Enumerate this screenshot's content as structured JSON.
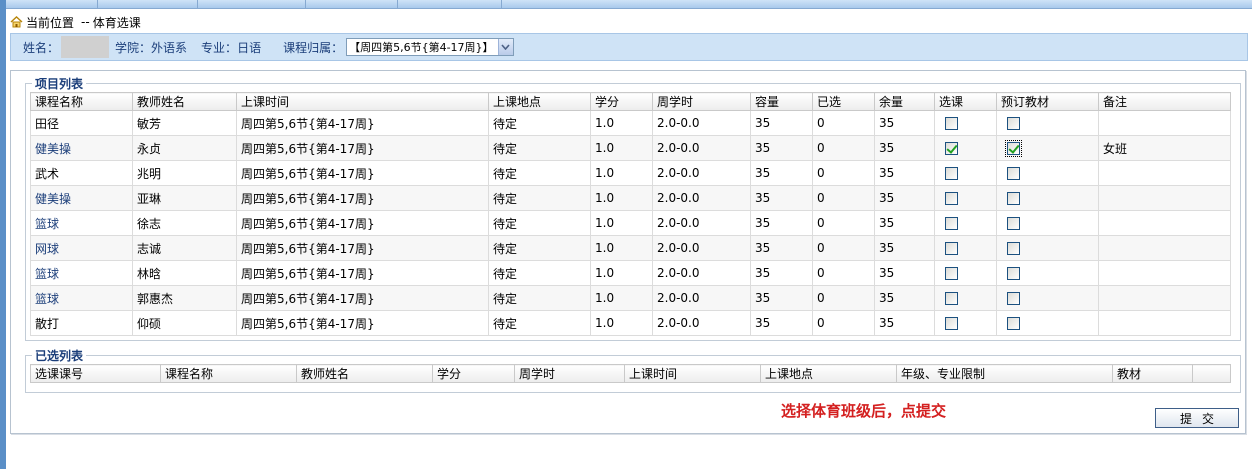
{
  "breadcrumb": {
    "prefix": "当前位置",
    "separator": "--",
    "page": "体育选课"
  },
  "info": {
    "name_label": "姓名：",
    "college_label": "学院：",
    "college_value": "外语系",
    "major_label": "专业：",
    "major_value": "日语",
    "belong_label": "课程归属：",
    "belong_selected": "【周四第5,6节{第4-17周}】"
  },
  "project_list": {
    "legend": "项目列表",
    "headers": [
      "课程名称",
      "教师姓名",
      "上课时间",
      "上课地点",
      "学分",
      "周学时",
      "容量",
      "已选",
      "余量",
      "选课",
      "预订教材",
      "备注"
    ],
    "rows": [
      {
        "course": "田径",
        "teacher": "敏芳",
        "time": "周四第5,6节{第4-17周}",
        "place": "待定",
        "credit": "1.0",
        "hours": "2.0-0.0",
        "capacity": "35",
        "selected": "0",
        "remaining": "35",
        "choose": false,
        "book": false,
        "note": ""
      },
      {
        "course": "健美操",
        "teacher": "永贞",
        "time": "周四第5,6节{第4-17周}",
        "place": "待定",
        "credit": "1.0",
        "hours": "2.0-0.0",
        "capacity": "35",
        "selected": "0",
        "remaining": "35",
        "choose": true,
        "book": true,
        "note": "女班"
      },
      {
        "course": "武术",
        "teacher": "兆明",
        "time": "周四第5,6节{第4-17周}",
        "place": "待定",
        "credit": "1.0",
        "hours": "2.0-0.0",
        "capacity": "35",
        "selected": "0",
        "remaining": "35",
        "choose": false,
        "book": false,
        "note": ""
      },
      {
        "course": "健美操",
        "teacher": "亚琳",
        "time": "周四第5,6节{第4-17周}",
        "place": "待定",
        "credit": "1.0",
        "hours": "2.0-0.0",
        "capacity": "35",
        "selected": "0",
        "remaining": "35",
        "choose": false,
        "book": false,
        "note": ""
      },
      {
        "course": "篮球",
        "teacher": "徐志",
        "time": "周四第5,6节{第4-17周}",
        "place": "待定",
        "credit": "1.0",
        "hours": "2.0-0.0",
        "capacity": "35",
        "selected": "0",
        "remaining": "35",
        "choose": false,
        "book": false,
        "note": ""
      },
      {
        "course": "网球",
        "teacher": "志诚",
        "time": "周四第5,6节{第4-17周}",
        "place": "待定",
        "credit": "1.0",
        "hours": "2.0-0.0",
        "capacity": "35",
        "selected": "0",
        "remaining": "35",
        "choose": false,
        "book": false,
        "note": ""
      },
      {
        "course": "篮球",
        "teacher": "林晗",
        "time": "周四第5,6节{第4-17周}",
        "place": "待定",
        "credit": "1.0",
        "hours": "2.0-0.0",
        "capacity": "35",
        "selected": "0",
        "remaining": "35",
        "choose": false,
        "book": false,
        "note": ""
      },
      {
        "course": "篮球",
        "teacher": "郭惠杰",
        "time": "周四第5,6节{第4-17周}",
        "place": "待定",
        "credit": "1.0",
        "hours": "2.0-0.0",
        "capacity": "35",
        "selected": "0",
        "remaining": "35",
        "choose": false,
        "book": false,
        "note": ""
      },
      {
        "course": "散打",
        "teacher": "仰硕",
        "time": "周四第5,6节{第4-17周}",
        "place": "待定",
        "credit": "1.0",
        "hours": "2.0-0.0",
        "capacity": "35",
        "selected": "0",
        "remaining": "35",
        "choose": false,
        "book": false,
        "note": ""
      }
    ]
  },
  "selected_list": {
    "legend": "已选列表",
    "headers": [
      "选课课号",
      "课程名称",
      "教师姓名",
      "学分",
      "周学时",
      "上课时间",
      "上课地点",
      "年级、专业限制",
      "教材",
      ""
    ]
  },
  "hint": "选择体育班级后，点提交",
  "submit_label": "提交",
  "colors": {
    "accent": "#1b3e7a",
    "hint": "#d42020",
    "infobar": "#cfe3f6",
    "check": "#21a121"
  },
  "icons": {
    "breadcrumb": "home-icon",
    "select": "chevron-down-icon",
    "checkbox": "checkbox-icon"
  }
}
